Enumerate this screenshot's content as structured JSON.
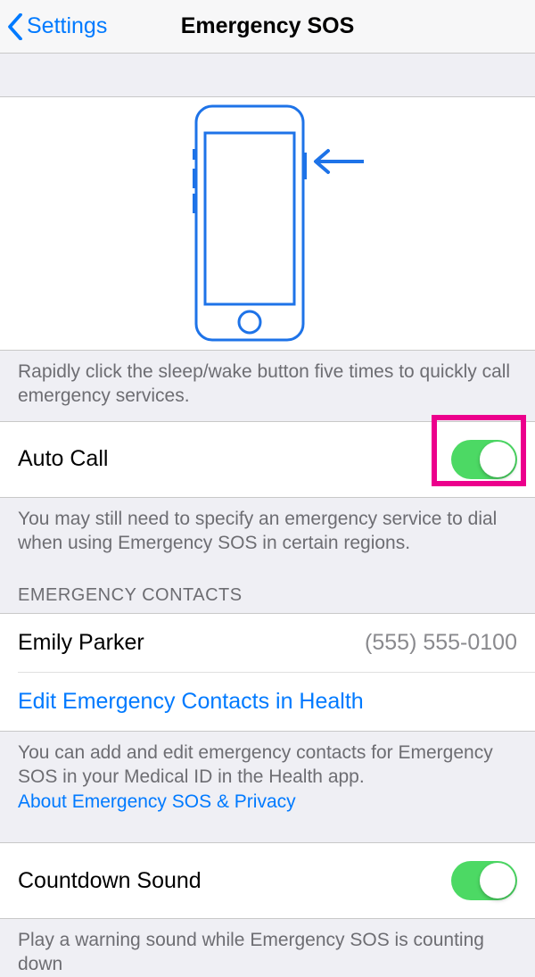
{
  "nav": {
    "back_label": "Settings",
    "title": "Emergency SOS"
  },
  "instruction": "Rapidly click the sleep/wake button five times to quickly call emergency services.",
  "autocall": {
    "label": "Auto Call",
    "on": true,
    "footer": "You may still need to specify an emergency service to dial when using Emergency SOS in certain regions."
  },
  "contacts": {
    "header": "EMERGENCY CONTACTS",
    "items": [
      {
        "name": "Emily Parker",
        "phone": "(555) 555-0100"
      }
    ],
    "edit_label": "Edit Emergency Contacts in Health",
    "footer_text": "You can add and edit emergency contacts for Emergency SOS in your Medical ID in the Health app.",
    "footer_link": "About Emergency SOS & Privacy"
  },
  "countdown": {
    "label": "Countdown Sound",
    "on": true,
    "footer": "Play a warning sound while Emergency SOS is counting down"
  },
  "colors": {
    "accent": "#007aff",
    "switch_on": "#4cd964",
    "highlight": "#ec008c"
  }
}
